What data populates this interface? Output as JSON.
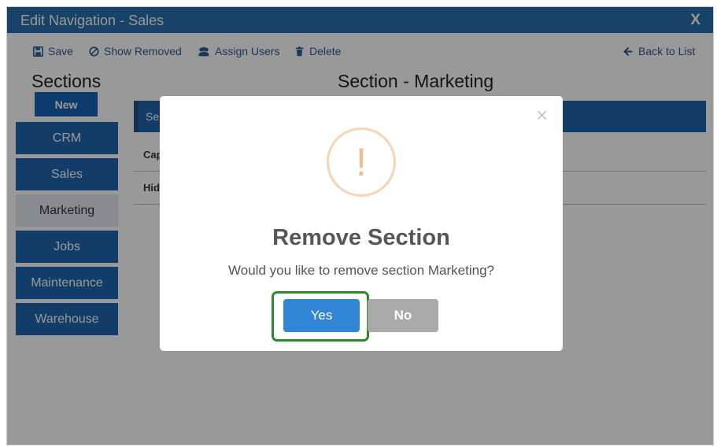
{
  "window": {
    "title": "Edit Navigation - Sales",
    "close_label": "X"
  },
  "toolbar": {
    "save": "Save",
    "show_removed": "Show Removed",
    "assign_users": "Assign Users",
    "delete": "Delete",
    "back": "Back to List"
  },
  "sidebar": {
    "title": "Sections",
    "new_label": "New",
    "items": [
      {
        "label": "CRM"
      },
      {
        "label": "Sales"
      },
      {
        "label": "Marketing"
      },
      {
        "label": "Jobs"
      },
      {
        "label": "Maintenance"
      },
      {
        "label": "Warehouse"
      }
    ]
  },
  "main": {
    "title": "Section - Marketing",
    "bar_text": "Se",
    "field_labels": [
      "Cap",
      "Hid"
    ]
  },
  "dialog": {
    "close_glyph": "×",
    "icon_glyph": "!",
    "title": "Remove Section",
    "message": "Would you like to remove section Marketing?",
    "yes_label": "Yes",
    "no_label": "No"
  },
  "colors": {
    "primary": "#1f67b0",
    "titlebar": "#2a6ead",
    "confirm": "#3085d6",
    "cancel": "#aaaaaa",
    "warning": "#f8bb86",
    "highlight": "#2b8a2b"
  }
}
